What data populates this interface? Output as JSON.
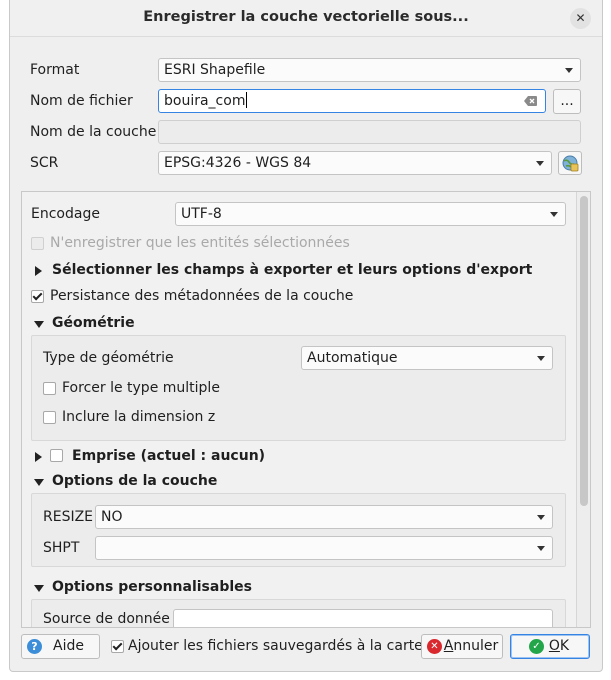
{
  "dialog": {
    "title": "Enregistrer la couche vectorielle sous...",
    "close_glyph": "✕"
  },
  "format": {
    "label": "Format",
    "value": "ESRI Shapefile"
  },
  "filename": {
    "label": "Nom de fichier",
    "value": "bouira_com",
    "browse_label": "..."
  },
  "layer_name": {
    "label": "Nom de la couche",
    "value": ""
  },
  "crs": {
    "label": "SCR",
    "value": "EPSG:4326 - WGS 84"
  },
  "encoding": {
    "label": "Encodage",
    "value": "UTF-8"
  },
  "selected_only": {
    "label": "N'enregistrer que les entités sélectionnées",
    "checked": false,
    "enabled": false
  },
  "fields_section": {
    "label": "Sélectionner les champs à exporter et leurs options d'export",
    "expanded": false
  },
  "metadata": {
    "label": "Persistance des métadonnées de la couche",
    "checked": true
  },
  "geometry": {
    "section_label": "Géométrie",
    "expanded": true,
    "type_label": "Type de géométrie",
    "type_value": "Automatique",
    "force_multi_label": "Forcer le type multiple",
    "force_multi_checked": false,
    "include_z_label": "Inclure la dimension z",
    "include_z_checked": false
  },
  "extent": {
    "label": "Emprise (actuel : aucun)",
    "expanded": false,
    "checked": false
  },
  "layer_options": {
    "section_label": "Options de la couche",
    "expanded": true,
    "resize_label": "RESIZE",
    "resize_value": "NO",
    "shpt_label": "SHPT",
    "shpt_value": ""
  },
  "custom_options": {
    "section_label": "Options personnalisables",
    "expanded": true,
    "source_label": "Source de donnée",
    "source_value": ""
  },
  "footer": {
    "help_label": "Aide",
    "help_icon_glyph": "?",
    "add_to_map_label": "Ajouter les fichiers sauvegardés à la carte",
    "add_to_map_checked": true,
    "cancel_label_first": "A",
    "cancel_label_rest": "nnuler",
    "cancel_icon_glyph": "✕",
    "ok_label_first": "O",
    "ok_label_rest": "K",
    "ok_icon_glyph": "✓"
  },
  "colors": {
    "accent": "#3584e4",
    "help": "#3d8ed8",
    "cancel": "#d9282e",
    "ok": "#23a54a"
  },
  "icons": {
    "crs_selector": "globe-icon",
    "clear": "clear-text-icon"
  }
}
